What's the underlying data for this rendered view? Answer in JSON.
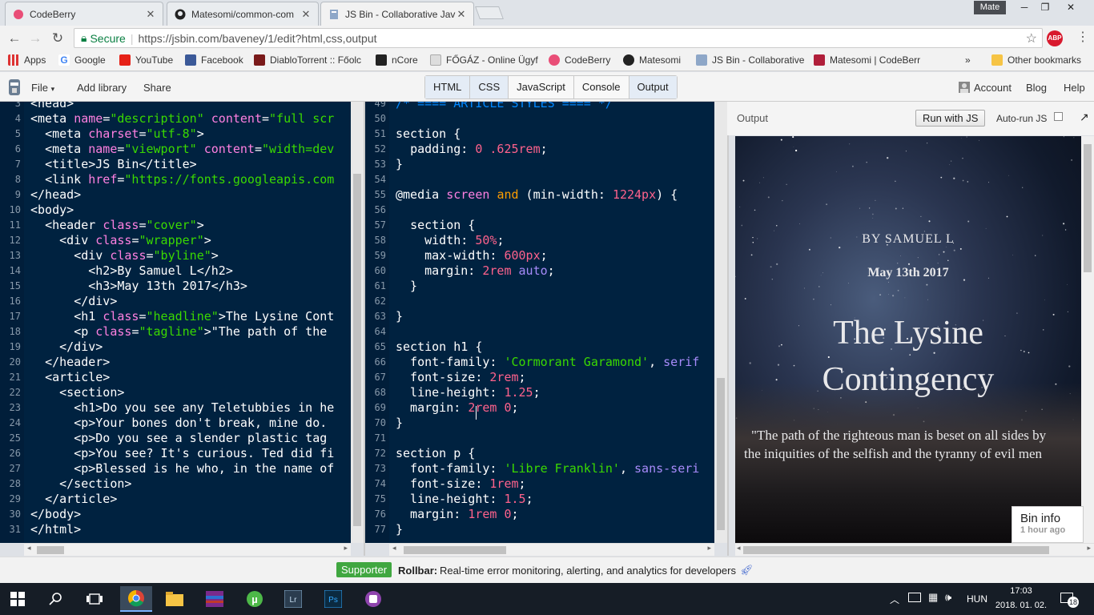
{
  "browser": {
    "tabs": [
      {
        "title": "CodeBerry",
        "active": false
      },
      {
        "title": "Matesomi/common-com",
        "active": false
      },
      {
        "title": "JS Bin - Collaborative Jav",
        "active": true
      }
    ],
    "profile": "Mate",
    "secure_label": "Secure",
    "url": "https://jsbin.com/baveney/1/edit?html,css,output",
    "bookmarks": [
      "Apps",
      "Google",
      "YouTube",
      "Facebook",
      "DiabloTorrent :: Főolc",
      "nCore",
      "FŐGÁZ - Online Ügyf",
      "CodeBerry",
      "Matesomi",
      "JS Bin - Collaborative",
      "Matesomi | CodeBerr"
    ],
    "more_bookmarks": "»",
    "other_bookmarks": "Other bookmarks"
  },
  "jsbin": {
    "menu": {
      "file": "File",
      "file_caret": "▾",
      "add_library": "Add library",
      "share": "Share"
    },
    "panels": [
      {
        "label": "HTML",
        "on": true
      },
      {
        "label": "CSS",
        "on": true
      },
      {
        "label": "JavaScript",
        "on": false
      },
      {
        "label": "Console",
        "on": false
      },
      {
        "label": "Output",
        "on": true
      }
    ],
    "right": {
      "account": "Account",
      "blog": "Blog",
      "help": "Help"
    }
  },
  "html_editor": {
    "lines": [
      {
        "n": "3",
        "html": "<span class='t'>&lt;head&gt;</span>"
      },
      {
        "n": "4",
        "html": "<span class='t'>&lt;meta </span><span class='attr'>name</span>=<span class='str'>\"description\"</span> <span class='attr'>content</span>=<span class='str'>\"full scr</span>"
      },
      {
        "n": "5",
        "html": "  <span class='t'>&lt;meta </span><span class='attr'>charset</span>=<span class='str'>\"utf-8\"</span><span class='t'>&gt;</span>"
      },
      {
        "n": "6",
        "html": "  <span class='t'>&lt;meta </span><span class='attr'>name</span>=<span class='str'>\"viewport\"</span> <span class='attr'>content</span>=<span class='str'>\"width=dev</span>"
      },
      {
        "n": "7",
        "html": "  <span class='t'>&lt;title&gt;JS Bin&lt;/title&gt;</span>"
      },
      {
        "n": "8",
        "html": "  <span class='t'>&lt;link </span><span class='attr'>href</span>=<span class='str'>\"https://fonts.googleapis.com</span>"
      },
      {
        "n": "9",
        "html": "<span class='t'>&lt;/head&gt;</span>"
      },
      {
        "n": "10",
        "html": "<span class='t'>&lt;body&gt;</span>"
      },
      {
        "n": "11",
        "html": "  <span class='t'>&lt;header </span><span class='attr'>class</span>=<span class='str'>\"cover\"</span><span class='t'>&gt;</span>"
      },
      {
        "n": "12",
        "html": "    <span class='t'>&lt;div </span><span class='attr'>class</span>=<span class='str'>\"wrapper\"</span><span class='t'>&gt;</span>"
      },
      {
        "n": "13",
        "html": "      <span class='t'>&lt;div </span><span class='attr'>class</span>=<span class='str'>\"byline\"</span><span class='t'>&gt;</span>"
      },
      {
        "n": "14",
        "html": "        <span class='t'>&lt;h2&gt;By Samuel L&lt;/h2&gt;</span>"
      },
      {
        "n": "15",
        "html": "        <span class='t'>&lt;h3&gt;May 13th 2017&lt;/h3&gt;</span>"
      },
      {
        "n": "16",
        "html": "      <span class='t'>&lt;/div&gt;</span>"
      },
      {
        "n": "17",
        "html": "      <span class='t'>&lt;h1 </span><span class='attr'>class</span>=<span class='str'>\"headline\"</span><span class='t'>&gt;The Lysine Cont</span>"
      },
      {
        "n": "18",
        "html": "      <span class='t'>&lt;p </span><span class='attr'>class</span>=<span class='str'>\"tagline\"</span><span class='t'>&gt;\"The path of the</span>"
      },
      {
        "n": "19",
        "html": "    <span class='t'>&lt;/div&gt;</span>"
      },
      {
        "n": "20",
        "html": "  <span class='t'>&lt;/header&gt;</span>"
      },
      {
        "n": "21",
        "html": "  <span class='t'>&lt;article&gt;</span>"
      },
      {
        "n": "22",
        "html": "    <span class='t'>&lt;section&gt;</span>"
      },
      {
        "n": "23",
        "html": "      <span class='t'>&lt;h1&gt;Do you see any Teletubbies in he</span>"
      },
      {
        "n": "24",
        "html": "      <span class='t'>&lt;p&gt;Your bones don't break, mine do.</span>"
      },
      {
        "n": "25",
        "html": "      <span class='t'>&lt;p&gt;Do you see a slender plastic tag</span>"
      },
      {
        "n": "26",
        "html": "      <span class='t'>&lt;p&gt;You see? It's curious. Ted did fi</span>"
      },
      {
        "n": "27",
        "html": "      <span class='t'>&lt;p&gt;Blessed is he who, in the name of</span>"
      },
      {
        "n": "28",
        "html": "    <span class='t'>&lt;/section&gt;</span>"
      },
      {
        "n": "29",
        "html": "  <span class='t'>&lt;/article&gt;</span>"
      },
      {
        "n": "30",
        "html": "<span class='t'>&lt;/body&gt;</span>"
      },
      {
        "n": "31",
        "html": "<span class='t'>&lt;/html&gt;</span>"
      }
    ]
  },
  "css_editor": {
    "lines": [
      {
        "n": "49",
        "html": "<span class='cmt'>/* ==== ARTICLE STYLES ==== */</span>"
      },
      {
        "n": "50",
        "html": ""
      },
      {
        "n": "51",
        "html": "<span class='sel'>section {</span>"
      },
      {
        "n": "52",
        "html": "  <span class='prop'>padding</span>: <span class='num'>0 .625rem</span>;"
      },
      {
        "n": "53",
        "html": "}"
      },
      {
        "n": "54",
        "html": ""
      },
      {
        "n": "55",
        "html": "<span class='sel'>@media</span> <span class='attr'>screen</span> <span class='kw'>and</span> (min-width: <span class='num'>1224px</span>) {"
      },
      {
        "n": "56",
        "html": ""
      },
      {
        "n": "57",
        "html": "  <span class='sel'>section {</span>"
      },
      {
        "n": "58",
        "html": "    width: <span class='num'>50%</span>;"
      },
      {
        "n": "59",
        "html": "    max-width: <span class='num'>600px</span>;"
      },
      {
        "n": "60",
        "html": "    margin: <span class='num'>2rem</span> <span class='val'>auto</span>;"
      },
      {
        "n": "61",
        "html": "  }"
      },
      {
        "n": "62",
        "html": ""
      },
      {
        "n": "63",
        "html": "}"
      },
      {
        "n": "64",
        "html": ""
      },
      {
        "n": "65",
        "html": "<span class='sel'>section h1 {</span>"
      },
      {
        "n": "66",
        "html": "  font-family: <span class='str'>'Cormorant Garamond'</span>, <span class='val'>serif</span>"
      },
      {
        "n": "67",
        "html": "  font-size: <span class='num'>2rem</span>;"
      },
      {
        "n": "68",
        "html": "  line-height: <span class='num'>1.25</span>;"
      },
      {
        "n": "69",
        "html": "  margin: <span class='num'>2rem</span> <span class='num'>0</span>;"
      },
      {
        "n": "70",
        "html": "}"
      },
      {
        "n": "71",
        "html": ""
      },
      {
        "n": "72",
        "html": "<span class='sel'>section p {</span>"
      },
      {
        "n": "73",
        "html": "  font-family: <span class='str'>'Libre Franklin'</span>, <span class='val'>sans-seri</span>"
      },
      {
        "n": "74",
        "html": "  font-size: <span class='num'>1rem</span>;"
      },
      {
        "n": "75",
        "html": "  line-height: <span class='num'>1.5</span>;"
      },
      {
        "n": "76",
        "html": "  margin: <span class='num'>1rem</span> <span class='num'>0</span>;"
      },
      {
        "n": "77",
        "html": "}"
      }
    ]
  },
  "output": {
    "label": "Output",
    "run_button": "Run with JS",
    "autorun_label": "Auto-run JS",
    "expand_icon": "↗",
    "byline": "BY SAMUEL L",
    "date": "May 13th 2017",
    "headline_1": "The Lysine",
    "headline_2": "Contingency",
    "tagline_1": "\"The path of the righteous man is beset on all sides by",
    "tagline_2": "the iniquities of the selfish and the tyranny of evil men"
  },
  "bin_info": {
    "title": "Bin info",
    "time": "1 hour ago"
  },
  "footer": {
    "supporter": "Supporter",
    "sponsor": "Rollbar:",
    "text": "Real-time error monitoring, alerting, and analytics for developers"
  },
  "taskbar": {
    "lang": "HUN",
    "time": "17:03",
    "date": "2018. 01. 02.",
    "notifications": "18"
  }
}
